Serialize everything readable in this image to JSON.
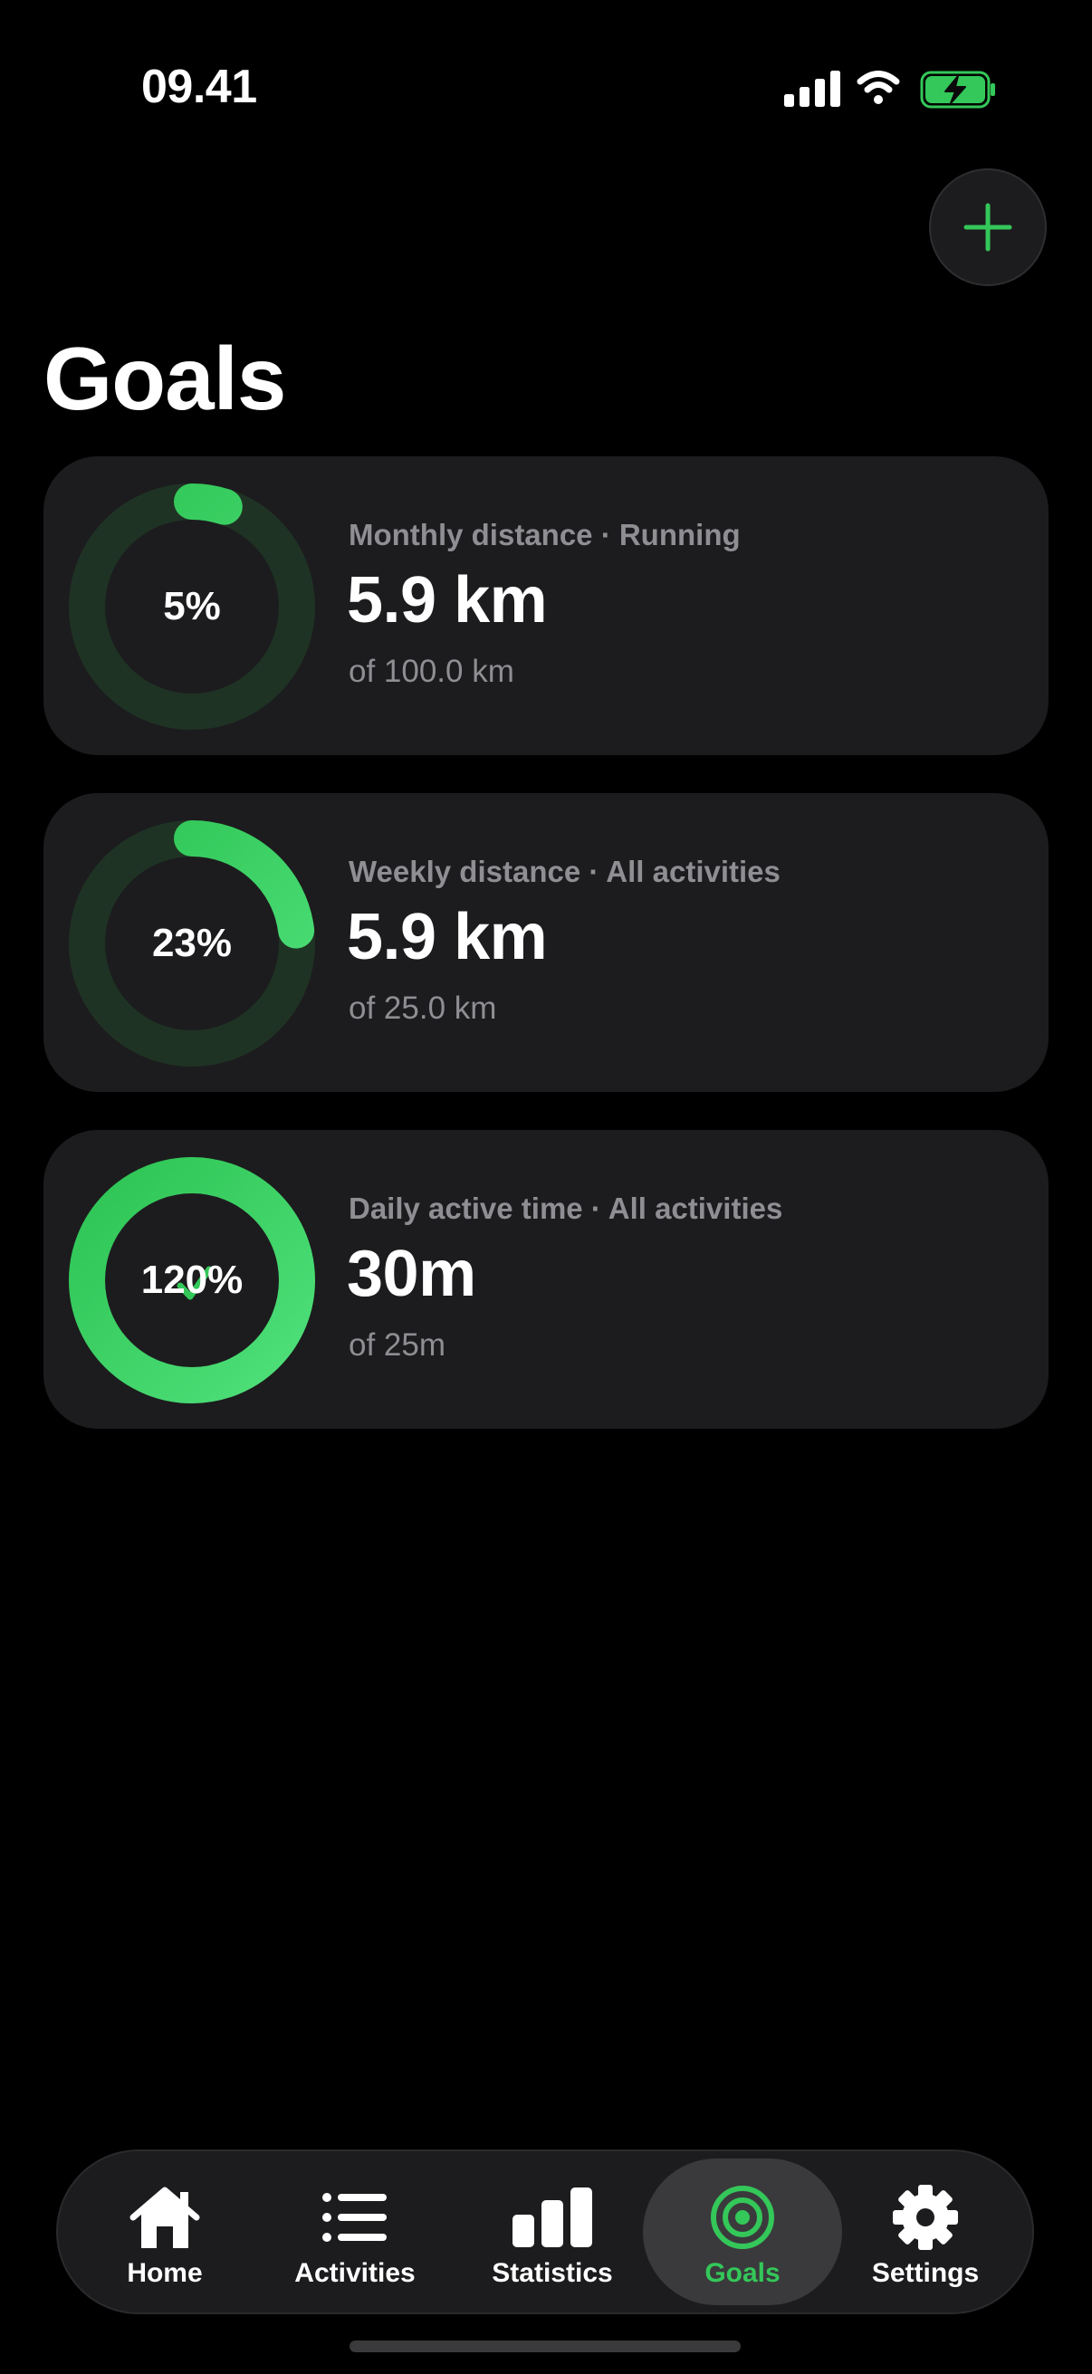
{
  "status_bar": {
    "time": "09.41"
  },
  "header": {
    "title": "Goals",
    "add_icon": "plus-icon"
  },
  "colors": {
    "accent": "#34c759",
    "ring_track": "#1f3324",
    "card": "#1c1c1e",
    "muted": "#8e8e93"
  },
  "goals": [
    {
      "subtitle": "Monthly distance · Running",
      "value": "5.9 km",
      "target": "of 100.0 km",
      "percent_label": "5%",
      "progress": 0.05,
      "completed": false
    },
    {
      "subtitle": "Weekly distance · All activities",
      "value": "5.9 km",
      "target": "of 25.0 km",
      "percent_label": "23%",
      "progress": 0.23,
      "completed": false
    },
    {
      "subtitle": "Daily active time · All activities",
      "value": "30m",
      "target": "of 25m",
      "percent_label": "120%",
      "progress": 1.2,
      "completed": true
    }
  ],
  "tabs": [
    {
      "label": "Home",
      "icon": "house-icon",
      "active": false
    },
    {
      "label": "Activities",
      "icon": "list-icon",
      "active": false
    },
    {
      "label": "Statistics",
      "icon": "bar-chart-icon",
      "active": false
    },
    {
      "label": "Goals",
      "icon": "target-icon",
      "active": true
    },
    {
      "label": "Settings",
      "icon": "gear-icon",
      "active": false
    }
  ]
}
